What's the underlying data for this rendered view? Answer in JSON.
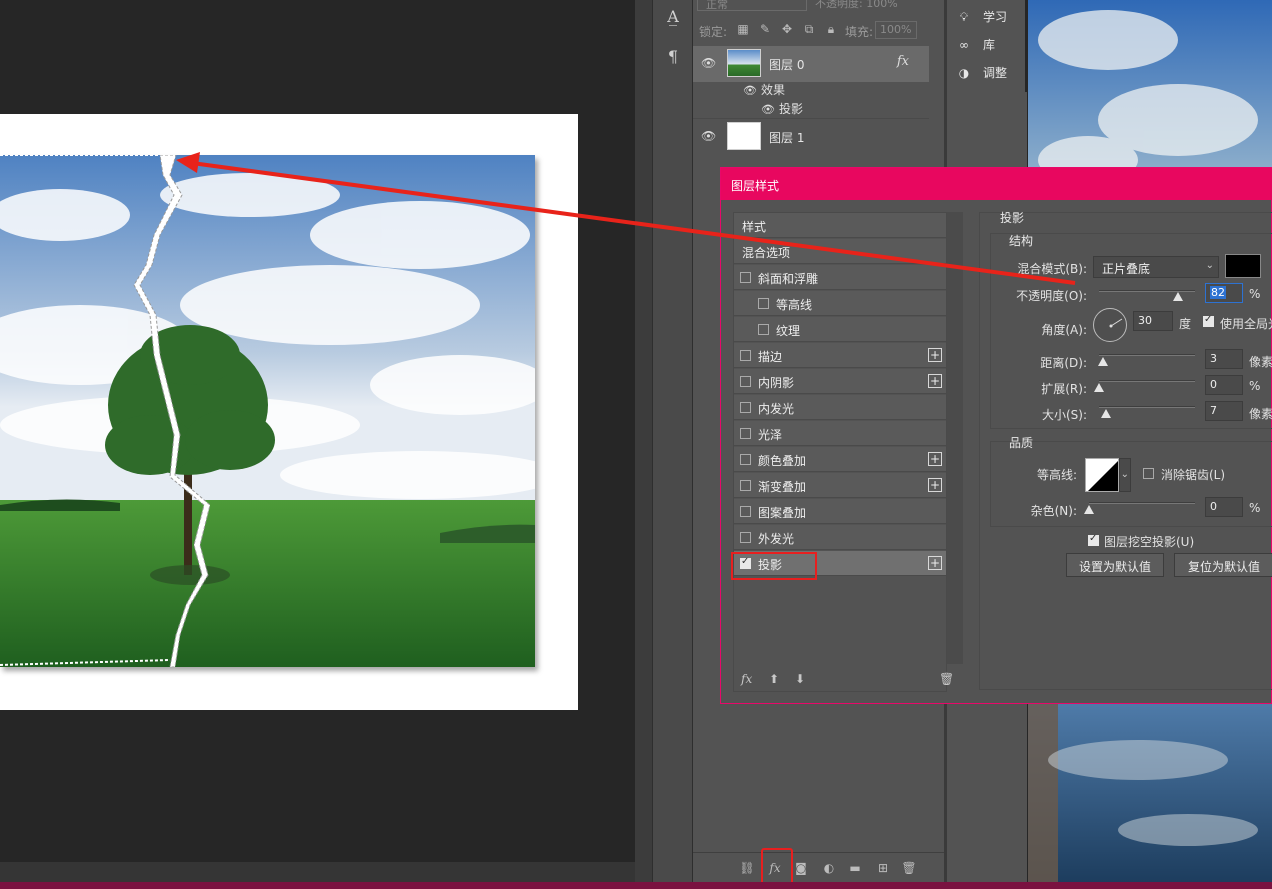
{
  "layers_panel": {
    "blend_mode": "正常",
    "opacity_label": "不透明度: 100%",
    "lock_label": "锁定:",
    "fill_label": "填充:",
    "fill_value": "100%",
    "layers": [
      {
        "name": "图层 0",
        "fx": "fx"
      },
      {
        "name": "图层 1"
      }
    ],
    "effects_label": "效果",
    "effect_item": "投影"
  },
  "mini_panel": {
    "items": [
      {
        "label": "学习",
        "icon": "lightbulb-icon"
      },
      {
        "label": "库",
        "icon": "cc-libraries-icon"
      },
      {
        "label": "调整",
        "icon": "adjustments-icon"
      }
    ]
  },
  "dialog": {
    "title": "图层样式",
    "styles": [
      {
        "label": "样式",
        "checkbox": false,
        "indent": 0
      },
      {
        "label": "混合选项",
        "checkbox": false,
        "indent": 0
      },
      {
        "label": "斜面和浮雕",
        "checkbox": true,
        "checked": false,
        "indent": 0
      },
      {
        "label": "等高线",
        "checkbox": true,
        "checked": false,
        "indent": 1
      },
      {
        "label": "纹理",
        "checkbox": true,
        "checked": false,
        "indent": 1
      },
      {
        "label": "描边",
        "checkbox": true,
        "checked": false,
        "plus": true
      },
      {
        "label": "内阴影",
        "checkbox": true,
        "checked": false,
        "plus": true
      },
      {
        "label": "内发光",
        "checkbox": true,
        "checked": false
      },
      {
        "label": "光泽",
        "checkbox": true,
        "checked": false
      },
      {
        "label": "颜色叠加",
        "checkbox": true,
        "checked": false,
        "plus": true
      },
      {
        "label": "渐变叠加",
        "checkbox": true,
        "checked": false,
        "plus": true
      },
      {
        "label": "图案叠加",
        "checkbox": true,
        "checked": false
      },
      {
        "label": "外发光",
        "checkbox": true,
        "checked": false
      },
      {
        "label": "投影",
        "checkbox": true,
        "checked": true,
        "plus": true,
        "selected": true
      }
    ],
    "list_tools": {
      "fx": "fx",
      "up": "⬆",
      "down": "⬇",
      "trash": "🗑"
    },
    "drop_shadow": {
      "title": "投影",
      "structure_title": "结构",
      "blend_mode_label": "混合模式(B):",
      "blend_mode_value": "正片叠底",
      "shadow_color": "#000000",
      "opacity_label": "不透明度(O):",
      "opacity_value": "82",
      "opacity_unit": "%",
      "opacity_level": 0.82,
      "angle_label": "角度(A):",
      "angle_value": "30",
      "angle_unit": "度",
      "global_light_label": "使用全局光",
      "global_light_checked": true,
      "distance_label": "距离(D):",
      "distance_value": "3",
      "distance_unit": "像素",
      "spread_label": "扩展(R):",
      "spread_value": "0",
      "spread_unit": "%",
      "size_label": "大小(S):",
      "size_value": "7",
      "size_unit": "像素",
      "quality_title": "品质",
      "contour_label": "等高线:",
      "antialias_label": "消除锯齿(L)",
      "noise_label": "杂色(N):",
      "noise_value": "0",
      "noise_unit": "%",
      "knockout_label": "图层挖空投影(U)",
      "knockout_checked": true,
      "set_default": "设置为默认值",
      "reset_default": "复位为默认值"
    }
  },
  "colors": {
    "dialog_title_bar": "#e8075f",
    "highlight": "#e81f1f",
    "accent_blue": "#2d72d2"
  }
}
